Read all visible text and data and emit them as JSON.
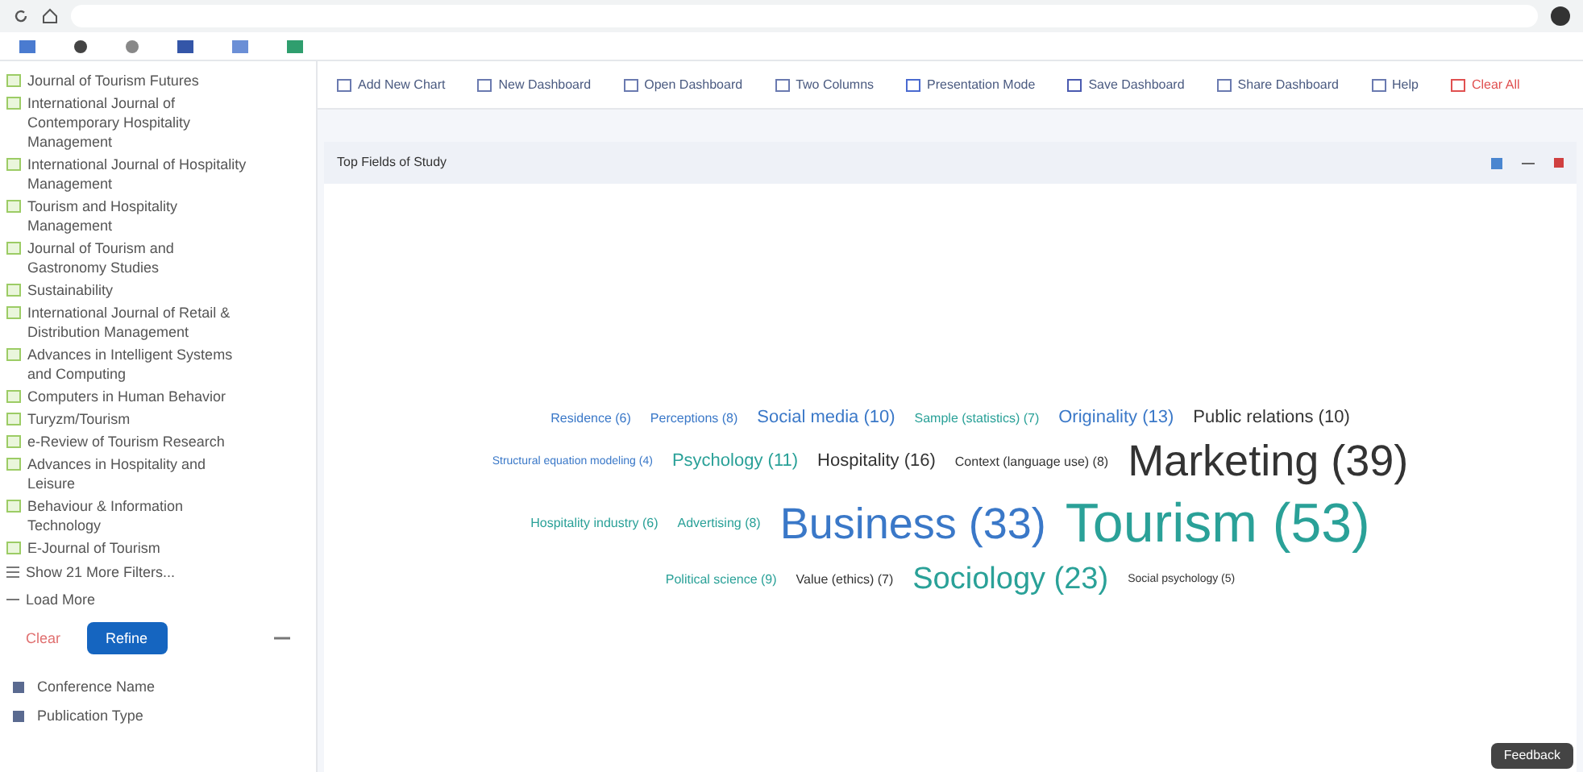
{
  "sidebar": {
    "items": [
      {
        "label": "Journal of Tourism Futures",
        "checked": true
      },
      {
        "label": "International Journal of Contemporary Hospitality Management",
        "checked": true
      },
      {
        "label": "International Journal of Hospitality Management",
        "checked": true
      },
      {
        "label": "Tourism and Hospitality Management",
        "checked": true
      },
      {
        "label": "Journal of Tourism and Gastronomy Studies",
        "checked": true
      },
      {
        "label": "Sustainability",
        "checked": true
      },
      {
        "label": "International Journal of Retail & Distribution Management",
        "checked": true
      },
      {
        "label": "Advances in Intelligent Systems and Computing",
        "checked": true
      },
      {
        "label": "Computers in Human Behavior",
        "checked": true
      },
      {
        "label": "Turyzm/Tourism",
        "checked": true
      },
      {
        "label": "e-Review of Tourism Research",
        "checked": true
      },
      {
        "label": "Advances in Hospitality and Leisure",
        "checked": true
      },
      {
        "label": "Behaviour & Information Technology",
        "checked": true
      },
      {
        "label": "E-Journal of Tourism",
        "checked": true
      }
    ],
    "show_more": "Show 21 More Filters...",
    "load_more": "Load More",
    "clear": "Clear",
    "refine": "Refine",
    "sections": [
      {
        "label": "Conference Name"
      },
      {
        "label": "Publication Type"
      }
    ]
  },
  "toolbar": [
    {
      "label": "Add New Chart",
      "kind": "chart"
    },
    {
      "label": "New Dashboard",
      "kind": "dash"
    },
    {
      "label": "Open Dashboard",
      "kind": "open"
    },
    {
      "label": "Two Columns",
      "kind": "cols"
    },
    {
      "label": "Presentation Mode",
      "kind": "present"
    },
    {
      "label": "Save Dashboard",
      "kind": "save"
    },
    {
      "label": "Share Dashboard",
      "kind": "share"
    },
    {
      "label": "Help",
      "kind": "help"
    },
    {
      "label": "Clear All",
      "kind": "clear"
    }
  ],
  "panel": {
    "title": "Top Fields of Study",
    "words": [
      {
        "text": "Residence (6)",
        "kind": "small",
        "color": "#3a78c8"
      },
      {
        "text": "Perceptions (8)",
        "kind": "small",
        "color": "#3a78c8"
      },
      {
        "text": "Social media (10)",
        "kind": "medium",
        "color": "#3a78c8"
      },
      {
        "text": "Sample (statistics) (7)",
        "kind": "small",
        "color": "#2aa198"
      },
      {
        "text": "Originality (13)",
        "kind": "medium",
        "color": "#3a78c8"
      },
      {
        "text": "Public relations (10)",
        "kind": "medium",
        "color": "#333333"
      },
      {
        "text": "Structural equation modeling (4)",
        "kind": "tiny",
        "color": "#3a78c8"
      },
      {
        "text": "Psychology (11)",
        "kind": "medium",
        "color": "#2aa198"
      },
      {
        "text": "Hospitality (16)",
        "kind": "medium",
        "color": "#333333"
      },
      {
        "text": "Context (language use) (8)",
        "kind": "small",
        "color": "#333333"
      },
      {
        "text": "Marketing (39)",
        "kind": "huge",
        "color": "#333333"
      },
      {
        "text": "Hospitality industry (6)",
        "kind": "small",
        "color": "#2aa198"
      },
      {
        "text": "Advertising (8)",
        "kind": "small",
        "color": "#2aa198"
      },
      {
        "text": "Business (33)",
        "kind": "huge",
        "color": "#3a78c8"
      },
      {
        "text": "Tourism (53)",
        "kind": "giant",
        "color": "#2aa198"
      },
      {
        "text": "Political science (9)",
        "kind": "small",
        "color": "#2aa198"
      },
      {
        "text": "Value (ethics) (7)",
        "kind": "small",
        "color": "#333333"
      },
      {
        "text": "Sociology (23)",
        "kind": "large",
        "color": "#2aa198"
      },
      {
        "text": "Social psychology (5)",
        "kind": "tiny",
        "color": "#333333"
      }
    ]
  },
  "feedback": "Feedback"
}
